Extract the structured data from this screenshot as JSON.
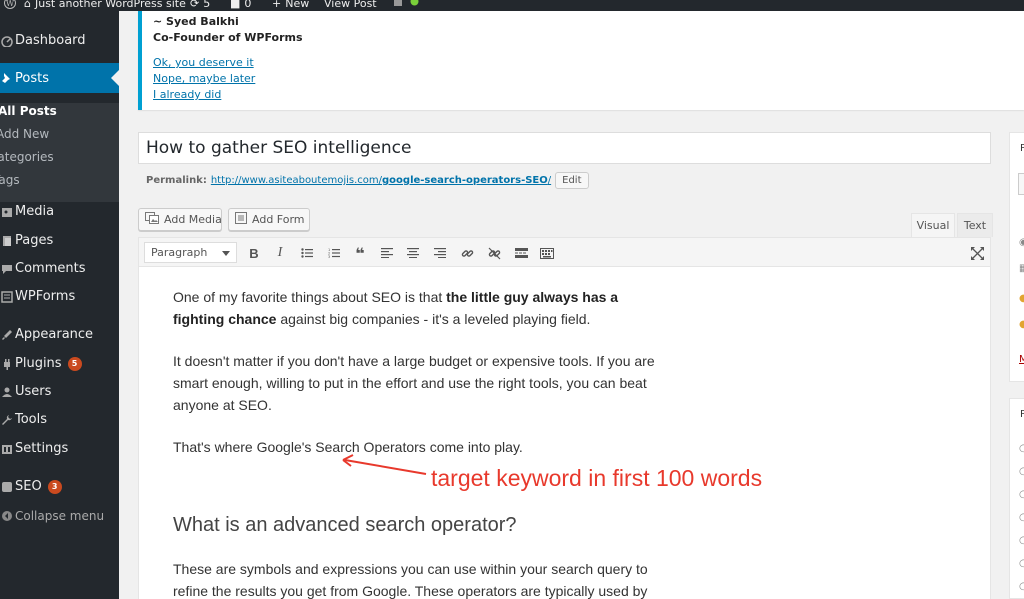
{
  "adminbar": {
    "site_name": "Just another WordPress site",
    "updates_count": "5",
    "comments_count": "0",
    "new_label": "New",
    "view_post_label": "View Post"
  },
  "sidebar": {
    "dashboard": "Dashboard",
    "posts": "Posts",
    "submenu": [
      "All Posts",
      "Add New",
      "Categories",
      "Tags"
    ],
    "media": "Media",
    "pages": "Pages",
    "comments": "Comments",
    "wpforms": "WPForms",
    "appearance": "Appearance",
    "plugins": "Plugins",
    "plugins_badge": "5",
    "users": "Users",
    "tools": "Tools",
    "settings": "Settings",
    "seo": "SEO",
    "seo_badge": "3",
    "collapse": "Collapse menu"
  },
  "notice": {
    "author": "~ Syed Balkhi",
    "role": "Co-Founder of WPForms",
    "link_deserve": "Ok, you deserve it",
    "link_later": "Nope, maybe later",
    "link_did": "I already did"
  },
  "editor": {
    "title": "How to gather SEO intelligence",
    "permalink_label": "Permalink:",
    "permalink_base": "http://www.asiteaboutemojis.com/",
    "permalink_slug": "google-search-operators-SEO",
    "permalink_trailing": "/",
    "edit_label": "Edit",
    "add_media_label": "Add Media",
    "add_form_label": "Add Form",
    "tab_visual": "Visual",
    "tab_text": "Text",
    "format_value": "Paragraph"
  },
  "content": {
    "p1_start": "One of my favorite things about SEO is that ",
    "p1_bold": "the little guy always has a fighting chance",
    "p1_end": " against big companies - it's a leveled playing field.",
    "p2": "It doesn't matter if you don't have a large budget or expensive tools. If you are smart enough, willing to put in the effort and use the right tools, you can beat anyone at SEO.",
    "p3": "That's where Google's Search Operators come into play.",
    "annotation": "target keyword in first 100 words",
    "subheading": "What is an advanced search operator?",
    "p4": "These are symbols and expressions you can use within your search query to refine the results you get from Google. These operators are typically used by"
  },
  "side": {
    "letter_1": "P",
    "letter_2": "M",
    "letter_3": "P"
  },
  "colors": {
    "admin_dark": "#23282d",
    "accent_blue": "#0073aa",
    "badge_orange": "#ca4a1f",
    "annotation_red": "#e8392c",
    "notice_border": "#00a0d2"
  }
}
